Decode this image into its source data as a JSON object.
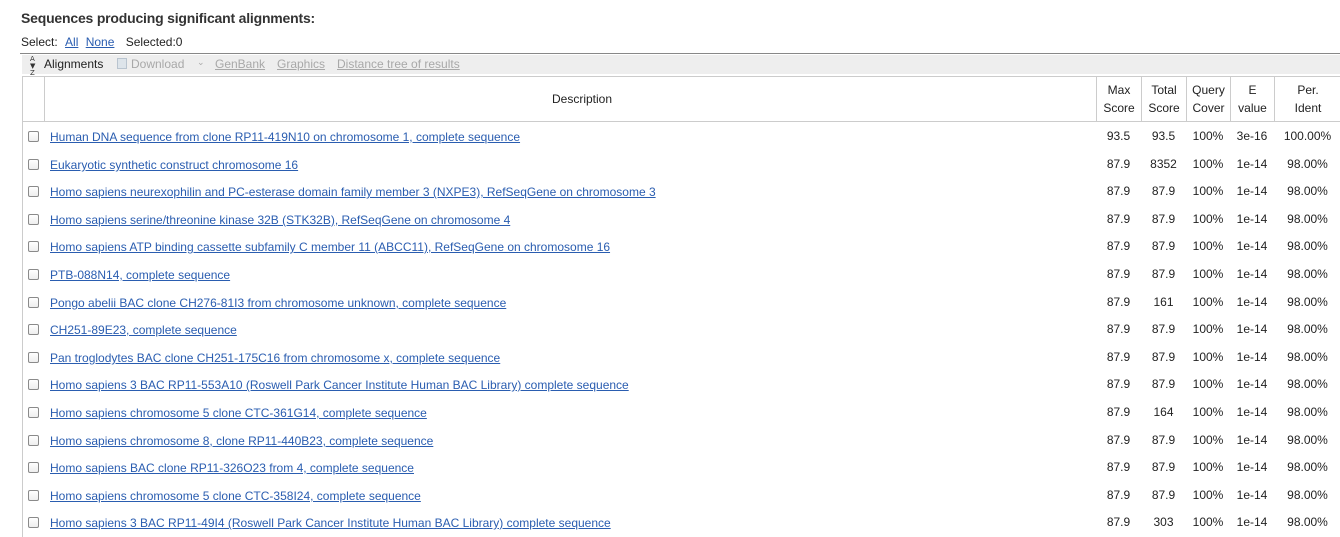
{
  "page_title": "Sequences producing significant alignments:",
  "select_bar": {
    "label": "Select:",
    "all": "All",
    "none": "None",
    "selected": "Selected:0"
  },
  "toolbar": {
    "sort_icon": "sort-icon",
    "alignments": "Alignments",
    "download_icon": "download-icon",
    "download": "Download",
    "download_chevron": "⌄",
    "genbank": "GenBank",
    "graphics": "Graphics",
    "distance_tree": "Distance tree of results"
  },
  "table": {
    "headers": {
      "description": "Description",
      "max_score_1": "Max",
      "max_score_2": "Score",
      "total_score_1": "Total",
      "total_score_2": "Score",
      "query_cover_1": "Query",
      "query_cover_2": "Cover",
      "e_value_1": "E",
      "e_value_2": "value",
      "per_ident_1": "Per.",
      "per_ident_2": "Ident"
    },
    "rows": [
      {
        "description": "Human DNA sequence from clone RP11-419N10 on chromosome 1, complete sequence",
        "max_score": "93.5",
        "total_score": "93.5",
        "query_cover": "100%",
        "e_value": "3e-16",
        "per_ident": "100.00%"
      },
      {
        "description": "Eukaryotic synthetic construct chromosome 16",
        "max_score": "87.9",
        "total_score": "8352",
        "query_cover": "100%",
        "e_value": "1e-14",
        "per_ident": "98.00%"
      },
      {
        "description": "Homo sapiens neurexophilin and PC-esterase domain family member 3 (NXPE3), RefSeqGene on chromosome 3",
        "max_score": "87.9",
        "total_score": "87.9",
        "query_cover": "100%",
        "e_value": "1e-14",
        "per_ident": "98.00%"
      },
      {
        "description": "Homo sapiens serine/threonine kinase 32B (STK32B), RefSeqGene on chromosome 4",
        "max_score": "87.9",
        "total_score": "87.9",
        "query_cover": "100%",
        "e_value": "1e-14",
        "per_ident": "98.00%"
      },
      {
        "description": "Homo sapiens ATP binding cassette subfamily C member 11 (ABCC11), RefSeqGene on chromosome 16",
        "max_score": "87.9",
        "total_score": "87.9",
        "query_cover": "100%",
        "e_value": "1e-14",
        "per_ident": "98.00%"
      },
      {
        "description": "PTB-088N14, complete sequence",
        "max_score": "87.9",
        "total_score": "87.9",
        "query_cover": "100%",
        "e_value": "1e-14",
        "per_ident": "98.00%"
      },
      {
        "description": "Pongo abelii BAC clone CH276-81I3 from chromosome unknown, complete sequence",
        "max_score": "87.9",
        "total_score": "161",
        "query_cover": "100%",
        "e_value": "1e-14",
        "per_ident": "98.00%"
      },
      {
        "description": "CH251-89E23, complete sequence",
        "max_score": "87.9",
        "total_score": "87.9",
        "query_cover": "100%",
        "e_value": "1e-14",
        "per_ident": "98.00%"
      },
      {
        "description": "Pan troglodytes BAC clone CH251-175C16 from chromosome x, complete sequence",
        "max_score": "87.9",
        "total_score": "87.9",
        "query_cover": "100%",
        "e_value": "1e-14",
        "per_ident": "98.00%"
      },
      {
        "description": "Homo sapiens 3 BAC RP11-553A10 (Roswell Park Cancer Institute Human BAC Library) complete sequence",
        "max_score": "87.9",
        "total_score": "87.9",
        "query_cover": "100%",
        "e_value": "1e-14",
        "per_ident": "98.00%"
      },
      {
        "description": "Homo sapiens chromosome 5 clone CTC-361G14, complete sequence",
        "max_score": "87.9",
        "total_score": "164",
        "query_cover": "100%",
        "e_value": "1e-14",
        "per_ident": "98.00%"
      },
      {
        "description": "Homo sapiens chromosome 8, clone RP11-440B23, complete sequence",
        "max_score": "87.9",
        "total_score": "87.9",
        "query_cover": "100%",
        "e_value": "1e-14",
        "per_ident": "98.00%"
      },
      {
        "description": "Homo sapiens BAC clone RP11-326O23 from 4, complete sequence",
        "max_score": "87.9",
        "total_score": "87.9",
        "query_cover": "100%",
        "e_value": "1e-14",
        "per_ident": "98.00%"
      },
      {
        "description": "Homo sapiens chromosome 5 clone CTC-358I24, complete sequence",
        "max_score": "87.9",
        "total_score": "87.9",
        "query_cover": "100%",
        "e_value": "1e-14",
        "per_ident": "98.00%"
      },
      {
        "description": "Homo sapiens 3 BAC RP11-49I4 (Roswell Park Cancer Institute Human BAC Library) complete sequence",
        "max_score": "87.9",
        "total_score": "303",
        "query_cover": "100%",
        "e_value": "1e-14",
        "per_ident": "98.00%"
      }
    ]
  },
  "colors": {
    "link": "#2a5db0",
    "toolbar_bg": "#eeeeee",
    "disabled_text": "#a8a8a8",
    "border": "#cccccc"
  }
}
